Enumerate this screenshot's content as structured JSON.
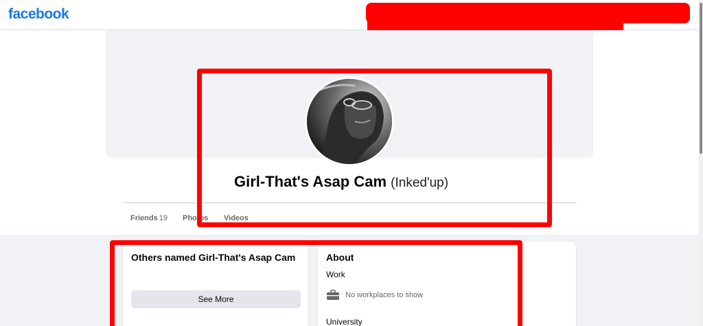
{
  "header": {
    "logo_text": "facebook",
    "logo_color": "#1877f2"
  },
  "profile": {
    "name": "Girl-That's Asap Cam",
    "alternate_name": "(Inked'up)"
  },
  "tabs": [
    {
      "label": "Friends",
      "count": "19"
    },
    {
      "label": "Photos"
    },
    {
      "label": "Videos"
    }
  ],
  "others_card": {
    "title": "Others named Girl-That's Asap Cam",
    "button_label": "See More"
  },
  "about_card": {
    "title": "About",
    "work_label": "Work",
    "work_empty_text": "No workplaces to show",
    "university_label": "University"
  },
  "annotation_color": "#ff0000"
}
